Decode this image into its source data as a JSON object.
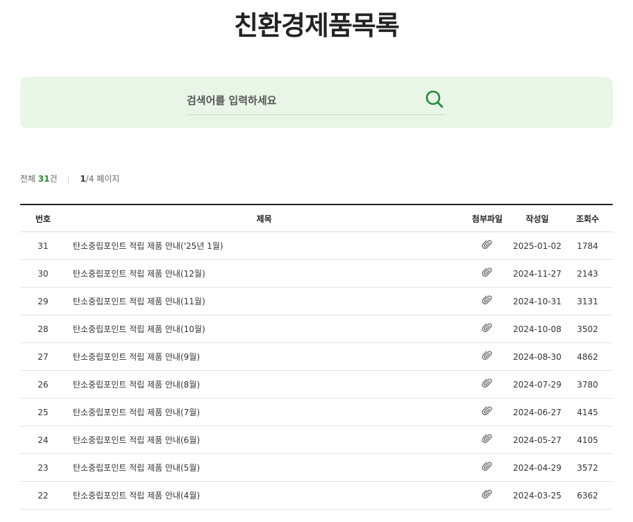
{
  "page": {
    "title": "친환경제품목록"
  },
  "search": {
    "placeholder": "검색어를 입력하세요"
  },
  "summary": {
    "total_prefix": "전체 ",
    "total_count": "31",
    "total_suffix": "건",
    "page_current": "1",
    "page_rest": "/4 페이지"
  },
  "table": {
    "headers": {
      "number": "번호",
      "title": "제목",
      "attachment": "첨부파일",
      "date": "작성일",
      "views": "조회수"
    },
    "rows": [
      {
        "number": "31",
        "title": "탄소중립포인트 적립 제품 안내('25년 1월)",
        "attachment_icon": "paperclip-icon",
        "date": "2025-01-02",
        "views": "1784"
      },
      {
        "number": "30",
        "title": "탄소중립포인트 적립 제품 안내(12월)",
        "attachment_icon": "paperclip-icon",
        "date": "2024-11-27",
        "views": "2143"
      },
      {
        "number": "29",
        "title": "탄소중립포인트 적립 제품 안내(11월)",
        "attachment_icon": "paperclip-icon",
        "date": "2024-10-31",
        "views": "3131"
      },
      {
        "number": "28",
        "title": "탄소중립포인트 적립 제품 안내(10월)",
        "attachment_icon": "paperclip-icon",
        "date": "2024-10-08",
        "views": "3502"
      },
      {
        "number": "27",
        "title": "탄소중립포인트 적립 제품 안내(9월)",
        "attachment_icon": "paperclip-icon",
        "date": "2024-08-30",
        "views": "4862"
      },
      {
        "number": "26",
        "title": "탄소중립포인트 적립 제품 안내(8월)",
        "attachment_icon": "paperclip-icon",
        "date": "2024-07-29",
        "views": "3780"
      },
      {
        "number": "25",
        "title": "탄소중립포인트 적립 제품 안내(7월)",
        "attachment_icon": "paperclip-icon",
        "date": "2024-06-27",
        "views": "4145"
      },
      {
        "number": "24",
        "title": "탄소중립포인트 적립 제품 안내(6월)",
        "attachment_icon": "paperclip-icon",
        "date": "2024-05-27",
        "views": "4105"
      },
      {
        "number": "23",
        "title": "탄소중립포인트 적립 제품 안내(5월)",
        "attachment_icon": "paperclip-icon",
        "date": "2024-04-29",
        "views": "3572"
      },
      {
        "number": "22",
        "title": "탄소중립포인트 적립 제품 안내(4월)",
        "attachment_icon": "paperclip-icon",
        "date": "2024-03-25",
        "views": "6362"
      }
    ]
  },
  "colors": {
    "accent_green": "#2a8a2a",
    "search_bg": "#e9f6e7",
    "search_icon": "#1f8a3a"
  }
}
